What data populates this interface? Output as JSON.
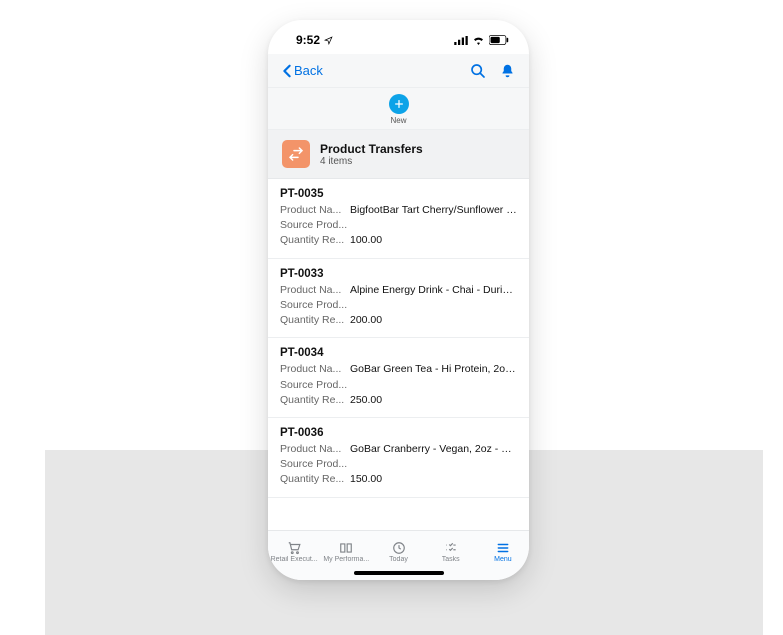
{
  "status": {
    "time": "9:52",
    "loc_icon": "location-arrow"
  },
  "nav": {
    "back_label": "Back",
    "search_icon": "search",
    "bell_icon": "bell",
    "new_label": "New"
  },
  "header": {
    "title": "Product Transfers",
    "subtitle": "4 items"
  },
  "fields": {
    "product_name": "Product Na...",
    "source_prod": "Source Prod...",
    "quantity_re": "Quantity Re..."
  },
  "items": [
    {
      "id": "PT-0035",
      "product": "BigfootBar Tart Cherry/Sunflower -...",
      "source": "",
      "qty": "100.00"
    },
    {
      "id": "PT-0033",
      "product": "Alpine Energy Drink - Chai - During...",
      "source": "",
      "qty": "200.00"
    },
    {
      "id": "PT-0034",
      "product": "GoBar Green Tea - Hi Protein, 2oz -...",
      "source": "",
      "qty": "250.00"
    },
    {
      "id": "PT-0036",
      "product": "GoBar Cranberry - Vegan, 2oz - 24 ...",
      "source": "",
      "qty": "150.00"
    }
  ],
  "tabs": [
    {
      "label": "Retail Execut...",
      "active": false
    },
    {
      "label": "My Performa...",
      "active": false
    },
    {
      "label": "Today",
      "active": false
    },
    {
      "label": "Tasks",
      "active": false
    },
    {
      "label": "Menu",
      "active": true
    }
  ]
}
